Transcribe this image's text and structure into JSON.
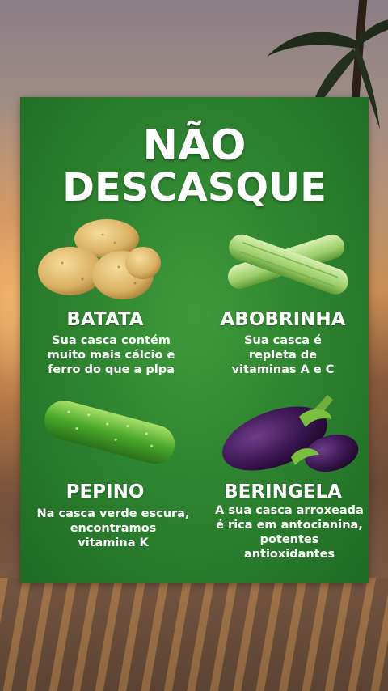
{
  "poster": {
    "title_line1": "NÃO",
    "title_line2": "DESCASQUE"
  },
  "items": [
    {
      "name": "BATATA",
      "description": "Sua casca contém\nmuito mais cálcio e\nferro do que a plpa",
      "icon": "potato-icon"
    },
    {
      "name": "ABOBRINHA",
      "description": "Sua casca é\nrepleta de\nvitaminas A e C",
      "icon": "zucchini-icon"
    },
    {
      "name": "PEPINO",
      "description": "Na casca verde escura,\nencontramos\nvitamina K",
      "icon": "cucumber-icon"
    },
    {
      "name": "BERINGELA",
      "description": "A sua casca arroxeada\né rica em antocianina,\npotentes antioxidantes",
      "icon": "eggplant-icon"
    }
  ],
  "colors": {
    "poster_green": "#2e8430",
    "text": "#ffffff"
  }
}
